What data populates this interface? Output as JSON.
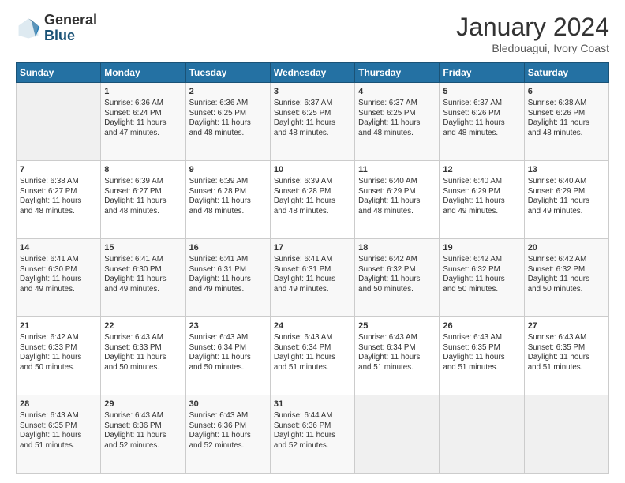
{
  "header": {
    "logo_general": "General",
    "logo_blue": "Blue",
    "month_title": "January 2024",
    "subtitle": "Bledouagui, Ivory Coast"
  },
  "days_of_week": [
    "Sunday",
    "Monday",
    "Tuesday",
    "Wednesday",
    "Thursday",
    "Friday",
    "Saturday"
  ],
  "weeks": [
    [
      {
        "day": "",
        "content": ""
      },
      {
        "day": "1",
        "content": "Sunrise: 6:36 AM\nSunset: 6:24 PM\nDaylight: 11 hours\nand 47 minutes."
      },
      {
        "day": "2",
        "content": "Sunrise: 6:36 AM\nSunset: 6:25 PM\nDaylight: 11 hours\nand 48 minutes."
      },
      {
        "day": "3",
        "content": "Sunrise: 6:37 AM\nSunset: 6:25 PM\nDaylight: 11 hours\nand 48 minutes."
      },
      {
        "day": "4",
        "content": "Sunrise: 6:37 AM\nSunset: 6:25 PM\nDaylight: 11 hours\nand 48 minutes."
      },
      {
        "day": "5",
        "content": "Sunrise: 6:37 AM\nSunset: 6:26 PM\nDaylight: 11 hours\nand 48 minutes."
      },
      {
        "day": "6",
        "content": "Sunrise: 6:38 AM\nSunset: 6:26 PM\nDaylight: 11 hours\nand 48 minutes."
      }
    ],
    [
      {
        "day": "7",
        "content": "Sunrise: 6:38 AM\nSunset: 6:27 PM\nDaylight: 11 hours\nand 48 minutes."
      },
      {
        "day": "8",
        "content": "Sunrise: 6:39 AM\nSunset: 6:27 PM\nDaylight: 11 hours\nand 48 minutes."
      },
      {
        "day": "9",
        "content": "Sunrise: 6:39 AM\nSunset: 6:28 PM\nDaylight: 11 hours\nand 48 minutes."
      },
      {
        "day": "10",
        "content": "Sunrise: 6:39 AM\nSunset: 6:28 PM\nDaylight: 11 hours\nand 48 minutes."
      },
      {
        "day": "11",
        "content": "Sunrise: 6:40 AM\nSunset: 6:29 PM\nDaylight: 11 hours\nand 48 minutes."
      },
      {
        "day": "12",
        "content": "Sunrise: 6:40 AM\nSunset: 6:29 PM\nDaylight: 11 hours\nand 49 minutes."
      },
      {
        "day": "13",
        "content": "Sunrise: 6:40 AM\nSunset: 6:29 PM\nDaylight: 11 hours\nand 49 minutes."
      }
    ],
    [
      {
        "day": "14",
        "content": "Sunrise: 6:41 AM\nSunset: 6:30 PM\nDaylight: 11 hours\nand 49 minutes."
      },
      {
        "day": "15",
        "content": "Sunrise: 6:41 AM\nSunset: 6:30 PM\nDaylight: 11 hours\nand 49 minutes."
      },
      {
        "day": "16",
        "content": "Sunrise: 6:41 AM\nSunset: 6:31 PM\nDaylight: 11 hours\nand 49 minutes."
      },
      {
        "day": "17",
        "content": "Sunrise: 6:41 AM\nSunset: 6:31 PM\nDaylight: 11 hours\nand 49 minutes."
      },
      {
        "day": "18",
        "content": "Sunrise: 6:42 AM\nSunset: 6:32 PM\nDaylight: 11 hours\nand 50 minutes."
      },
      {
        "day": "19",
        "content": "Sunrise: 6:42 AM\nSunset: 6:32 PM\nDaylight: 11 hours\nand 50 minutes."
      },
      {
        "day": "20",
        "content": "Sunrise: 6:42 AM\nSunset: 6:32 PM\nDaylight: 11 hours\nand 50 minutes."
      }
    ],
    [
      {
        "day": "21",
        "content": "Sunrise: 6:42 AM\nSunset: 6:33 PM\nDaylight: 11 hours\nand 50 minutes."
      },
      {
        "day": "22",
        "content": "Sunrise: 6:43 AM\nSunset: 6:33 PM\nDaylight: 11 hours\nand 50 minutes."
      },
      {
        "day": "23",
        "content": "Sunrise: 6:43 AM\nSunset: 6:34 PM\nDaylight: 11 hours\nand 50 minutes."
      },
      {
        "day": "24",
        "content": "Sunrise: 6:43 AM\nSunset: 6:34 PM\nDaylight: 11 hours\nand 51 minutes."
      },
      {
        "day": "25",
        "content": "Sunrise: 6:43 AM\nSunset: 6:34 PM\nDaylight: 11 hours\nand 51 minutes."
      },
      {
        "day": "26",
        "content": "Sunrise: 6:43 AM\nSunset: 6:35 PM\nDaylight: 11 hours\nand 51 minutes."
      },
      {
        "day": "27",
        "content": "Sunrise: 6:43 AM\nSunset: 6:35 PM\nDaylight: 11 hours\nand 51 minutes."
      }
    ],
    [
      {
        "day": "28",
        "content": "Sunrise: 6:43 AM\nSunset: 6:35 PM\nDaylight: 11 hours\nand 51 minutes."
      },
      {
        "day": "29",
        "content": "Sunrise: 6:43 AM\nSunset: 6:36 PM\nDaylight: 11 hours\nand 52 minutes."
      },
      {
        "day": "30",
        "content": "Sunrise: 6:43 AM\nSunset: 6:36 PM\nDaylight: 11 hours\nand 52 minutes."
      },
      {
        "day": "31",
        "content": "Sunrise: 6:44 AM\nSunset: 6:36 PM\nDaylight: 11 hours\nand 52 minutes."
      },
      {
        "day": "",
        "content": ""
      },
      {
        "day": "",
        "content": ""
      },
      {
        "day": "",
        "content": ""
      }
    ]
  ]
}
